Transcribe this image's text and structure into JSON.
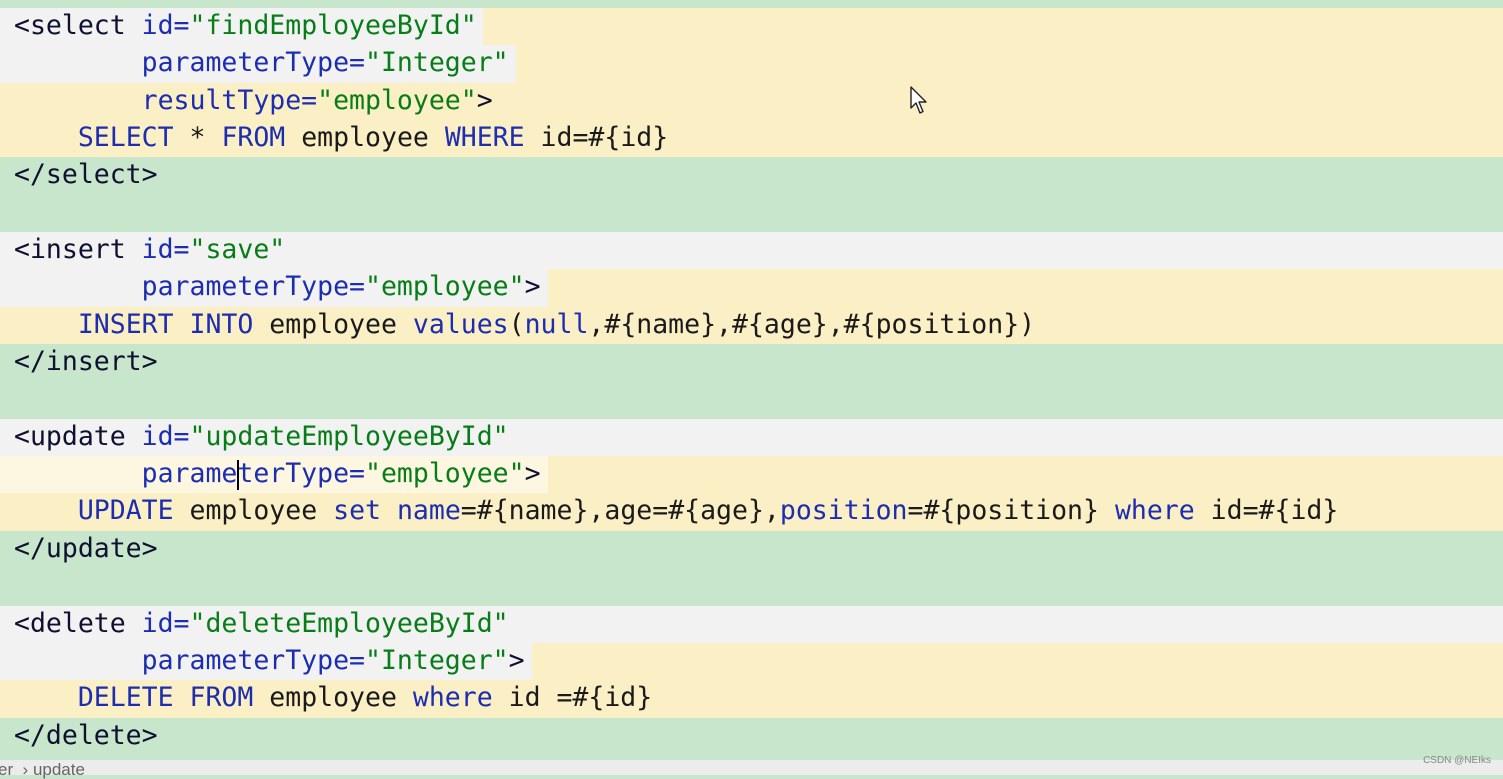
{
  "editor": {
    "lines": [
      {
        "bg": [
          "#f2f2f2",
          "#fbefc6"
        ],
        "tokens": [
          {
            "t": "<select ",
            "c": "tag"
          },
          {
            "t": "id=",
            "c": "attr"
          },
          {
            "t": "\"findEmployeeById\"",
            "c": "str"
          }
        ]
      },
      {
        "bg": [
          "#f2f2f2",
          "#fbefc6"
        ],
        "tokens": [
          {
            "t": "        ",
            "c": "plain"
          },
          {
            "t": "parameterType=",
            "c": "attr"
          },
          {
            "t": "\"Integer\"",
            "c": "str"
          }
        ]
      },
      {
        "bg": [
          "#fbefc6"
        ],
        "tokens": [
          {
            "t": "        ",
            "c": "plain"
          },
          {
            "t": "resultType=",
            "c": "attr"
          },
          {
            "t": "\"employee\"",
            "c": "str"
          },
          {
            "t": ">",
            "c": "tag"
          }
        ]
      },
      {
        "bg": [
          "#fbefc6"
        ],
        "tokens": [
          {
            "t": "    ",
            "c": "plain"
          },
          {
            "t": "SELECT",
            "c": "kw"
          },
          {
            "t": " * ",
            "c": "plain"
          },
          {
            "t": "FROM",
            "c": "kw"
          },
          {
            "t": " employee ",
            "c": "plain"
          },
          {
            "t": "WHERE",
            "c": "kw"
          },
          {
            "t": " id=#{id}",
            "c": "plain"
          }
        ]
      },
      {
        "bg": [
          "#c8e6cb"
        ],
        "tokens": [
          {
            "t": "</select>",
            "c": "tag"
          }
        ]
      },
      {
        "bg": [
          "#c8e6cb"
        ],
        "tokens": []
      },
      {
        "bg": [
          "#f2f2f2"
        ],
        "tokens": [
          {
            "t": "<insert ",
            "c": "tag"
          },
          {
            "t": "id=",
            "c": "attr"
          },
          {
            "t": "\"save\"",
            "c": "str"
          }
        ]
      },
      {
        "bg": [
          "#f2f2f2",
          "#fbefc6"
        ],
        "tokens": [
          {
            "t": "        ",
            "c": "plain"
          },
          {
            "t": "parameterType=",
            "c": "attr"
          },
          {
            "t": "\"employee\"",
            "c": "str"
          },
          {
            "t": ">",
            "c": "tag"
          }
        ]
      },
      {
        "bg": [
          "#fbefc6"
        ],
        "tokens": [
          {
            "t": "    ",
            "c": "plain"
          },
          {
            "t": "INSERT INTO",
            "c": "kw"
          },
          {
            "t": " employee ",
            "c": "plain"
          },
          {
            "t": "values",
            "c": "kw"
          },
          {
            "t": "(",
            "c": "plain"
          },
          {
            "t": "null",
            "c": "kw"
          },
          {
            "t": ",#{name},#{age},#{position})",
            "c": "plain"
          }
        ]
      },
      {
        "bg": [
          "#c8e6cb"
        ],
        "tokens": [
          {
            "t": "</insert>",
            "c": "tag"
          }
        ]
      },
      {
        "bg": [
          "#c8e6cb"
        ],
        "tokens": []
      },
      {
        "bg": [
          "#f2f2f2"
        ],
        "tokens": [
          {
            "t": "<update ",
            "c": "tag"
          },
          {
            "t": "id=",
            "c": "attr"
          },
          {
            "t": "\"updateEmployeeById\"",
            "c": "str"
          }
        ]
      },
      {
        "bg": [
          "#fdf6e0",
          "#fbefc6"
        ],
        "tokens": [
          {
            "t": "        ",
            "c": "plain"
          },
          {
            "t": "parameterType=",
            "c": "attr"
          },
          {
            "t": "\"employee\"",
            "c": "str"
          },
          {
            "t": ">",
            "c": "tag"
          }
        ]
      },
      {
        "bg": [
          "#fbefc6"
        ],
        "tokens": [
          {
            "t": "    ",
            "c": "plain"
          },
          {
            "t": "UPDATE",
            "c": "kw"
          },
          {
            "t": " employee ",
            "c": "plain"
          },
          {
            "t": "set",
            "c": "kw"
          },
          {
            "t": " ",
            "c": "plain"
          },
          {
            "t": "name",
            "c": "kw"
          },
          {
            "t": "=#{name},age=#{age},",
            "c": "plain"
          },
          {
            "t": "position",
            "c": "kw"
          },
          {
            "t": "=#{position} ",
            "c": "plain"
          },
          {
            "t": "where",
            "c": "kw"
          },
          {
            "t": " id=#{id}",
            "c": "plain"
          }
        ]
      },
      {
        "bg": [
          "#c8e6cb"
        ],
        "tokens": [
          {
            "t": "</update>",
            "c": "tag"
          }
        ]
      },
      {
        "bg": [
          "#c8e6cb"
        ],
        "tokens": []
      },
      {
        "bg": [
          "#f2f2f2"
        ],
        "tokens": [
          {
            "t": "<delete ",
            "c": "tag"
          },
          {
            "t": "id=",
            "c": "attr"
          },
          {
            "t": "\"deleteEmployeeById\"",
            "c": "str"
          }
        ]
      },
      {
        "bg": [
          "#f2f2f2",
          "#fbefc6"
        ],
        "tokens": [
          {
            "t": "        ",
            "c": "plain"
          },
          {
            "t": "parameterType=",
            "c": "attr"
          },
          {
            "t": "\"Integer\"",
            "c": "str"
          },
          {
            "t": ">",
            "c": "tag"
          }
        ]
      },
      {
        "bg": [
          "#fbefc6"
        ],
        "tokens": [
          {
            "t": "    ",
            "c": "plain"
          },
          {
            "t": "DELETE FROM",
            "c": "kw"
          },
          {
            "t": " employee ",
            "c": "plain"
          },
          {
            "t": "where",
            "c": "kw"
          },
          {
            "t": " id =#{id}",
            "c": "plain"
          }
        ]
      },
      {
        "bg": [
          "#c8e6cb"
        ],
        "tokens": [
          {
            "t": "</delete>",
            "c": "tag"
          }
        ]
      }
    ]
  },
  "breadcrumb": "er  › update",
  "watermark": "CSDN @NEIks",
  "colors": {
    "editor_bg": "#c8e6cb",
    "highlight_yellow": "#fbefc6",
    "line_gray": "#f2f2f2",
    "attr_blue": "#1c2db0",
    "string_green": "#067d17"
  }
}
